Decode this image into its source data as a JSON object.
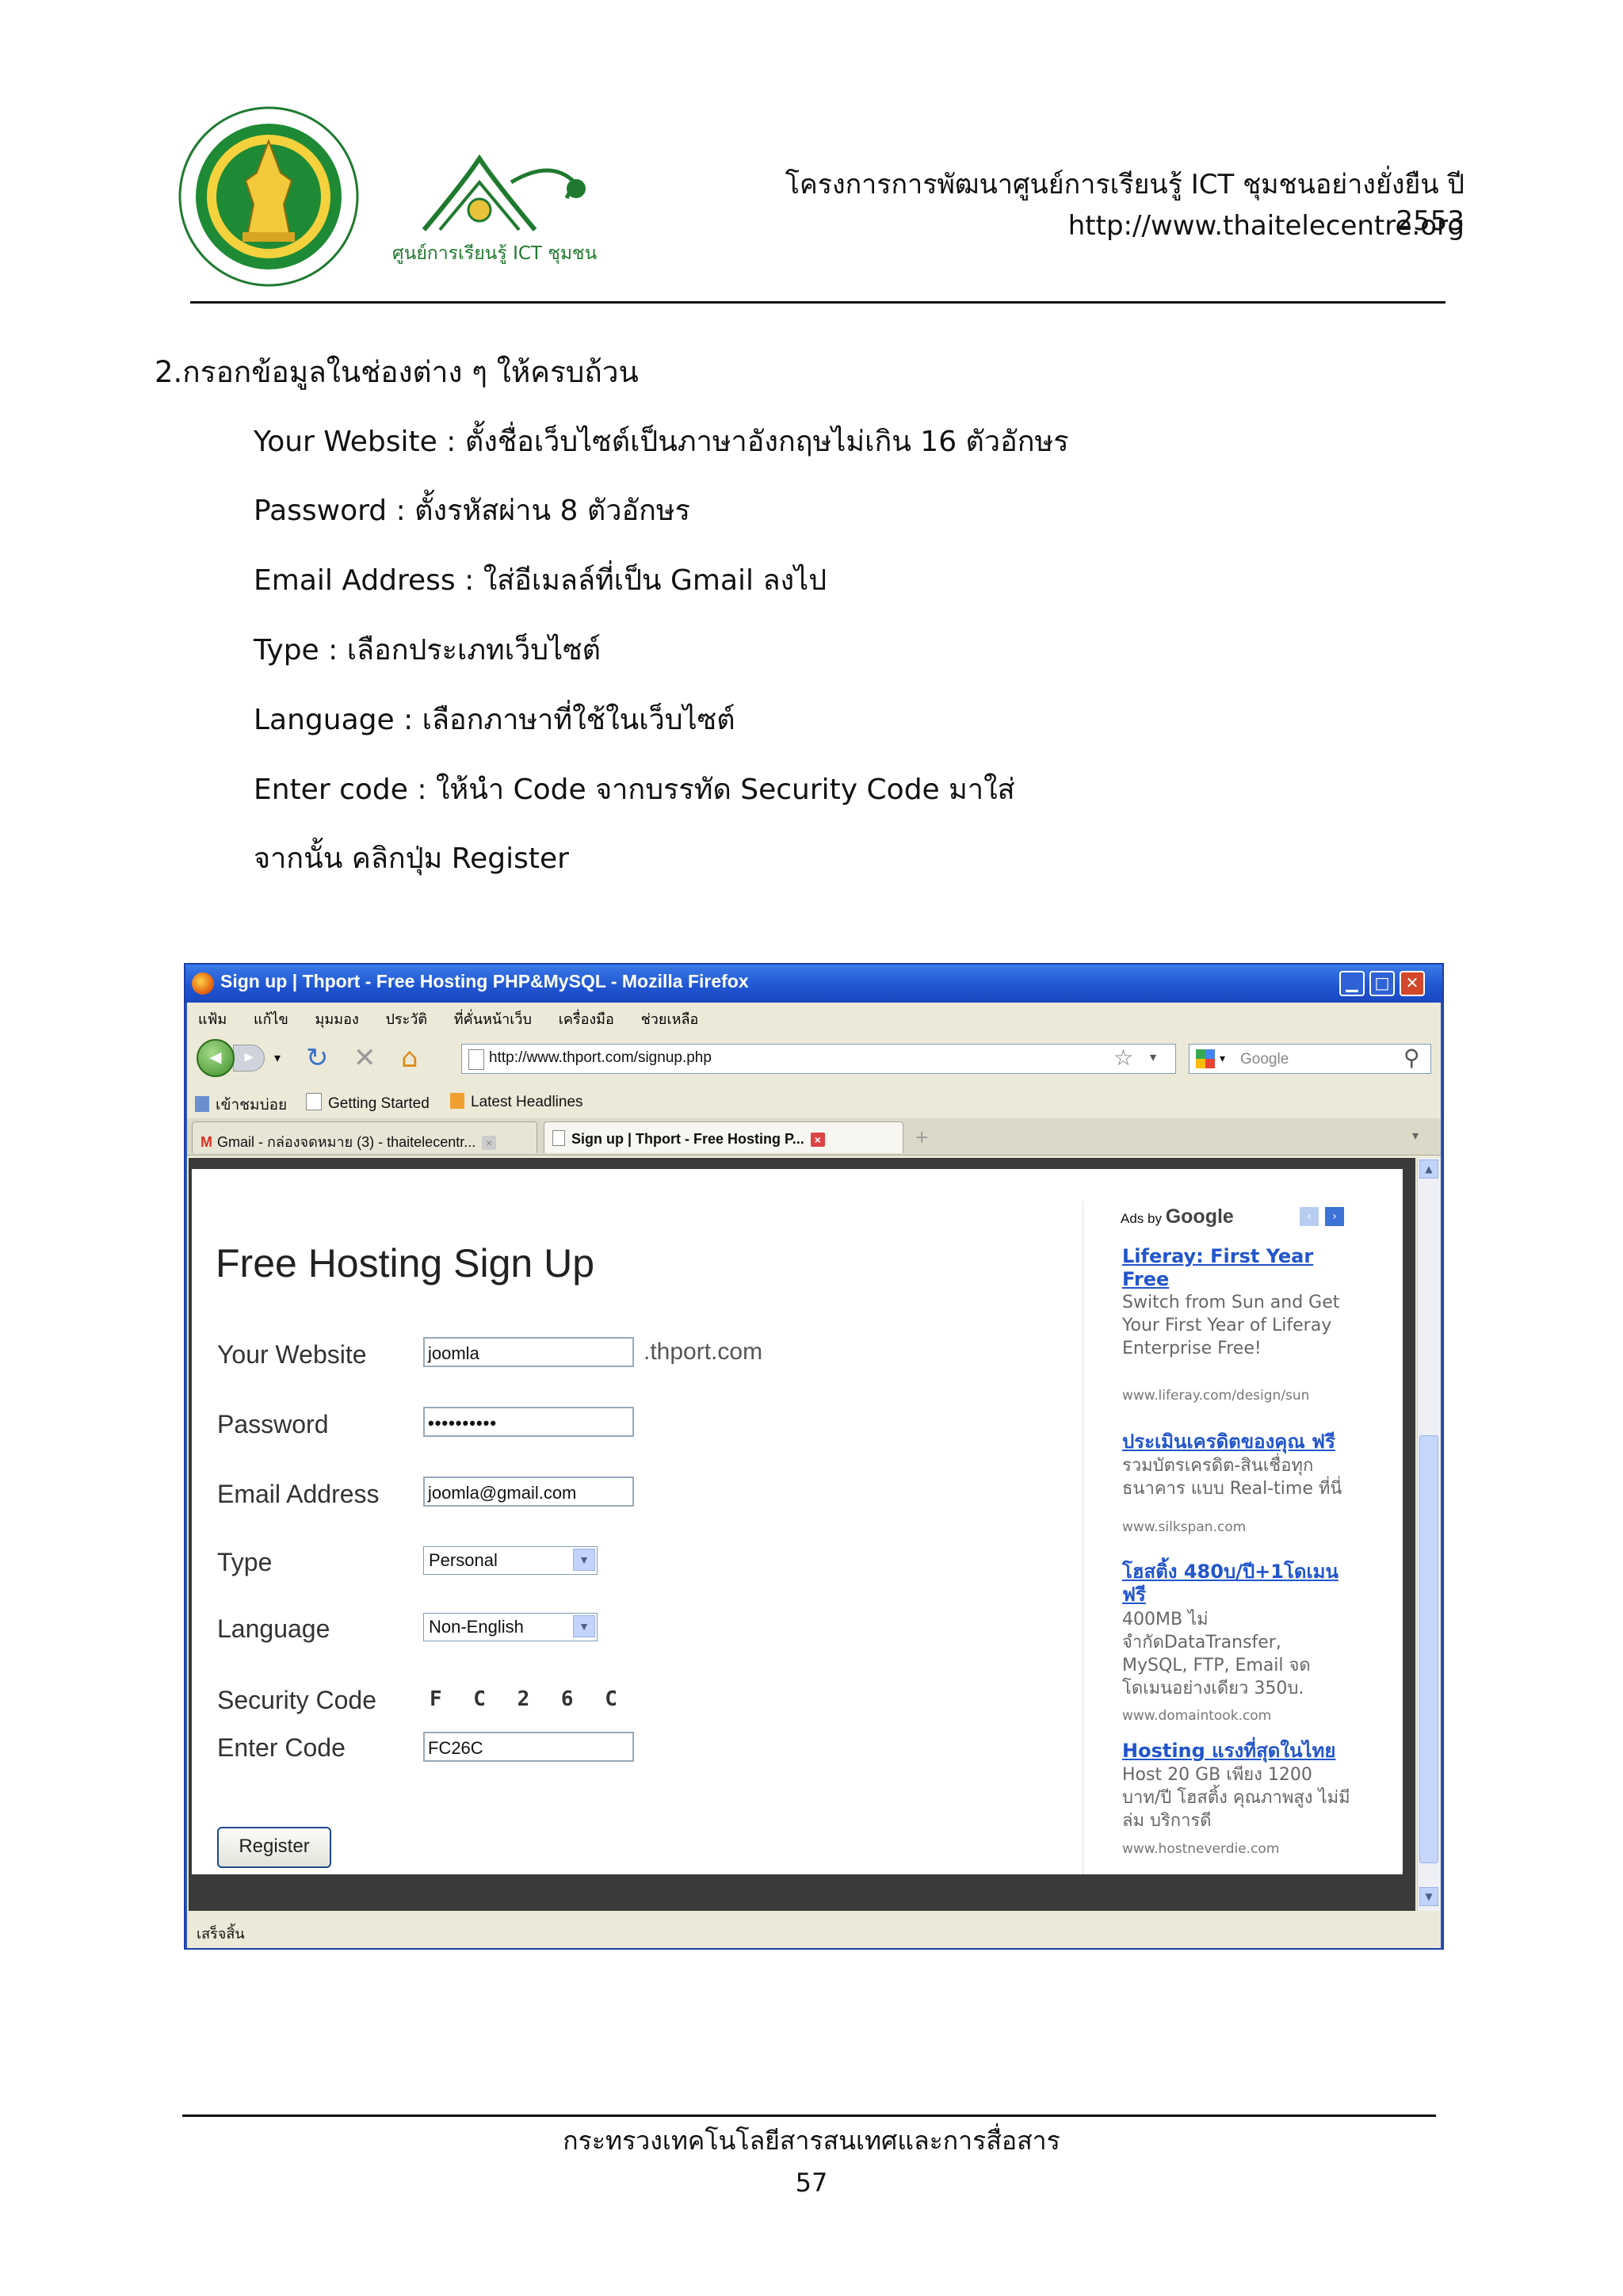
{
  "header": {
    "project": "โครงการการพัฒนาศูนย์การเรียนรู้ ICT ชุมชนอย่างยั่งยืน ปี 2553",
    "url": "http://www.thaitelecentre.org",
    "logo_text": "ศูนย์การเรียนรู้ ICT ชุมชน"
  },
  "instructions": {
    "step_title": "2.กรอกข้อมูลในช่องต่าง ๆ ให้ครบถ้วน",
    "lines": [
      "Your Website : ตั้งชื่อเว็บไซต์เป็นภาษาอังกฤษไม่เกิน 16 ตัวอักษร",
      "Password : ตั้งรหัสผ่าน 8 ตัวอักษร",
      "Email Address : ใส่อีเมลล์ที่เป็น Gmail ลงไป",
      "Type : เลือกประเภทเว็บไซต์",
      "Language : เลือกภาษาที่ใช้ในเว็บไซต์",
      "Enter code : ให้นำ Code จากบรรทัด Security Code มาใส่",
      "จากนั้น คลิกปุ่ม Register"
    ]
  },
  "browser": {
    "title": "Sign up | Thport - Free Hosting PHP&MySQL - Mozilla Firefox",
    "menu": [
      "แฟ้ม",
      "แก้ไข",
      "มุมมอง",
      "ประวัติ",
      "ที่คั่นหน้าเว็บ",
      "เครื่องมือ",
      "ช่วยเหลือ"
    ],
    "address": "http://www.thport.com/signup.php",
    "search_placeholder": "Google",
    "bookmarks": [
      "เข้าชมบ่อย",
      "Getting Started",
      "Latest Headlines"
    ],
    "tabs": [
      {
        "label": "Gmail - กล่องจดหมาย (3) - thaitelecentr...",
        "active": false
      },
      {
        "label": "Sign up | Thport - Free Hosting P...",
        "active": true
      }
    ],
    "status": "เสร็จสิ้น"
  },
  "form": {
    "title": "Free Hosting Sign Up",
    "website_label": "Your Website",
    "website_value": "joomla",
    "domain_suffix": ".thport.com",
    "password_label": "Password",
    "password_value": "••••••••••",
    "email_label": "Email Address",
    "email_value": "joomla@gmail.com",
    "type_label": "Type",
    "type_value": "Personal",
    "language_label": "Language",
    "language_value": "Non-English",
    "security_label": "Security Code",
    "security_value": "F C 2 6 C",
    "enter_code_label": "Enter Code",
    "enter_code_value": "FC26C",
    "register_label": "Register"
  },
  "ads": {
    "ads_by": "Ads by",
    "google": "Google",
    "items": [
      {
        "title": "Liferay: First Year Free",
        "desc": "Switch from Sun and Get Your First Year of Liferay Enterprise Free!",
        "url": "www.liferay.com/design/sun"
      },
      {
        "title": "ประเมินเครดิตของคุณ ฟรี",
        "desc": "รวมบัตรเครดิต-สินเชื่อทุกธนาคาร แบบ Real-time ที่นี่",
        "url": "www.silkspan.com"
      },
      {
        "title": "โฮสติ้ง 480บ/ปี+1โดเมนฟรี",
        "desc": "400MB ไม่จำกัดDataTransfer, MySQL, FTP, Email จดโดเมนอย่างเดียว 350บ.",
        "url": "www.domaintook.com"
      },
      {
        "title": "Hosting แรงที่สุดในไทย",
        "desc": "Host 20 GB เพียง 1200 บาท/ปี โฮสติ้ง คุณภาพสูง ไม่มีล่ม บริการดี",
        "url": "www.hostneverdie.com"
      }
    ]
  },
  "footer": {
    "ministry": "กระทรวงเทคโนโลยีสารสนเทศและการสื่อสาร",
    "page_number": "57"
  }
}
